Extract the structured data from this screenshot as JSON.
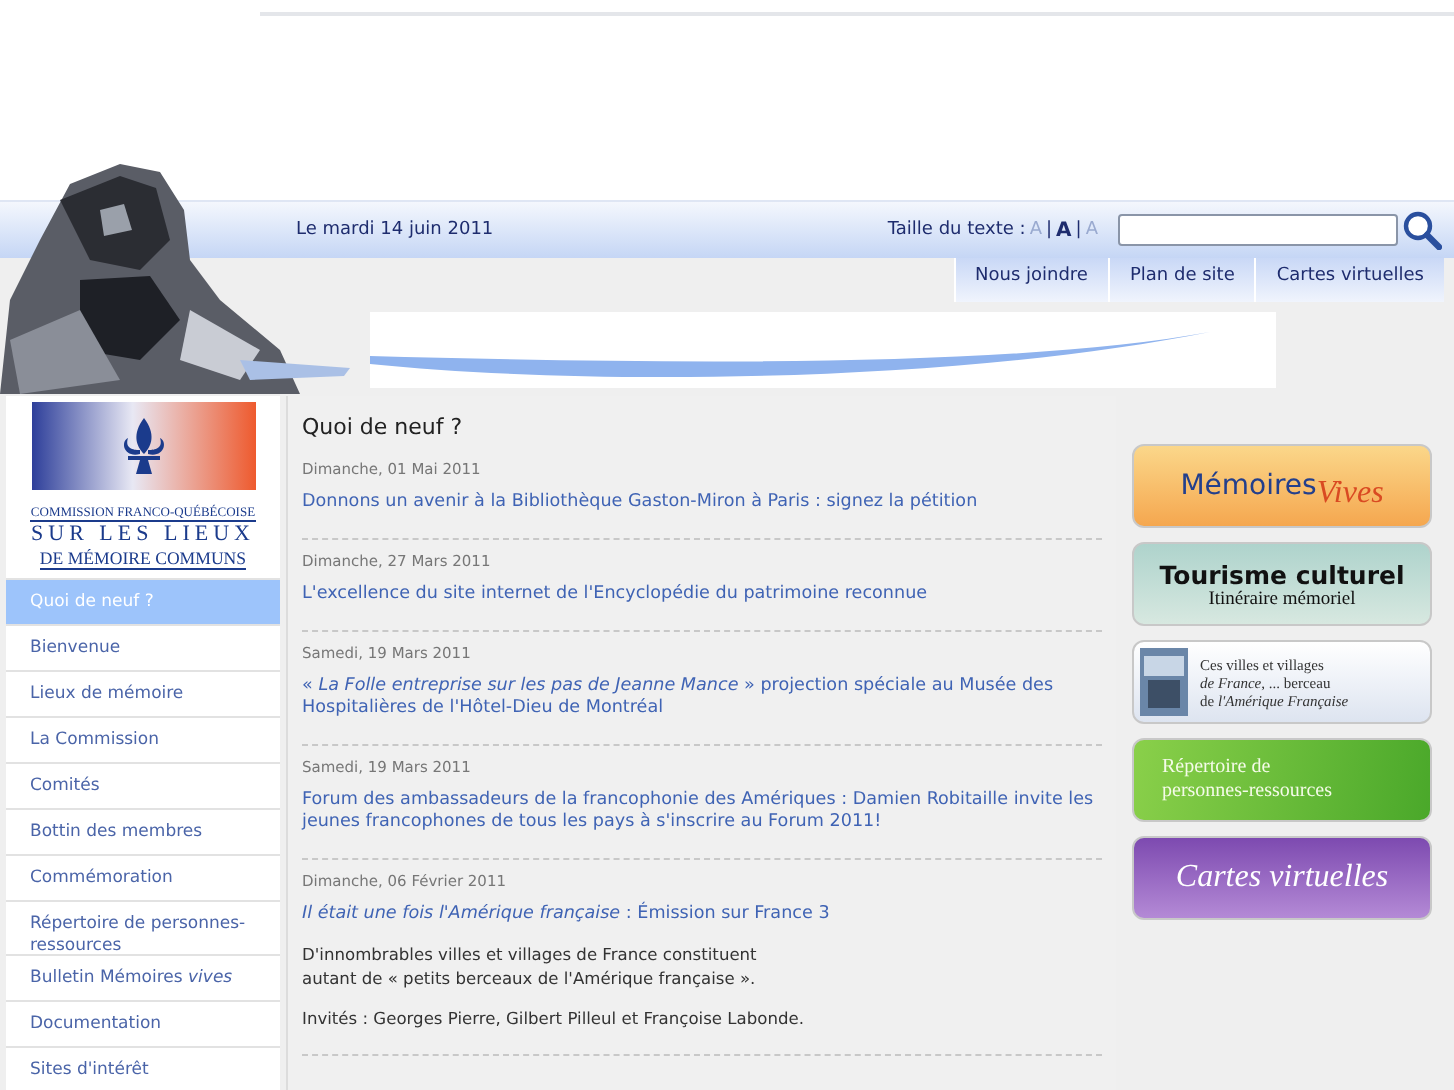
{
  "header": {
    "date": "Le mardi 14 juin 2011",
    "text_size_label": "Taille du texte :",
    "separators": [
      "|",
      "|"
    ],
    "text_sizes": [
      {
        "label": "A",
        "selected": false
      },
      {
        "label": "A",
        "selected": true
      },
      {
        "label": "A",
        "selected": false
      }
    ]
  },
  "top_links": [
    "Nous joindre",
    "Plan de site",
    "Cartes virtuelles"
  ],
  "logo": {
    "line_1": "COMMISSION FRANCO-QUÉBÉCOISE",
    "line_2": "SUR LES LIEUX",
    "line_3": "DE MÉMOIRE COMMUNS"
  },
  "sidebar": {
    "items": [
      {
        "label": "Quoi de neuf ?",
        "selected": true
      },
      {
        "label": "Bienvenue",
        "selected": false
      },
      {
        "label": "Lieux de mémoire",
        "selected": false
      },
      {
        "label": "La Commission",
        "selected": false
      },
      {
        "label": "Comités",
        "selected": false
      },
      {
        "label": "Bottin des membres",
        "selected": false
      },
      {
        "label": "Commémoration",
        "selected": false
      },
      {
        "label": "Répertoire de personnes-ressources",
        "selected": false
      },
      {
        "label": "Bulletin Mémoires *vives*",
        "selected": false
      },
      {
        "label": "Documentation",
        "selected": false
      },
      {
        "label": "Sites d'intérêt",
        "selected": false
      }
    ]
  },
  "main": {
    "title": "Quoi de neuf ?",
    "news": [
      {
        "date": "Dimanche, 01 Mai 2011",
        "title": "Donnons un avenir à la Bibliothèque Gaston-Miron à Paris : signez la pétition"
      },
      {
        "date": "Dimanche, 27 Mars 2011",
        "title": "L'excellence du site internet de l'Encyclopédie du patrimoine reconnue"
      },
      {
        "date": "Samedi, 19 Mars 2011",
        "title": "« *La Folle entreprise sur les pas de Jeanne Mance* » projection spéciale au Musée des Hospitalières de l'Hôtel-Dieu de Montréal"
      },
      {
        "date": "Samedi, 19 Mars 2011",
        "title": "Forum des ambassadeurs de la francophonie des Amériques : Damien Robitaille invite les jeunes francophones de tous les pays à s'inscrire au Forum 2011!"
      },
      {
        "date": "Dimanche, 06 Février 2011",
        "title": "*Il était une fois l'Amérique française* : Émission sur France 3",
        "paragraphs": [
          "D'innombrables villes et villages de France constituent\nautant de « petits berceaux de l'Amérique française ».",
          "Invités : Georges Pierre, Gilbert Pilleul et Françoise Labonde."
        ]
      }
    ]
  },
  "banners": [
    {
      "kind": "memoires",
      "text": "Mémoires",
      "text_2": "Vives"
    },
    {
      "kind": "tourisme",
      "text": "Tourisme culturel",
      "text_2": "Itinéraire mémoriel"
    },
    {
      "kind": "villes",
      "text": "Ces villes et villages\n*de France*, ... berceau\nde *l'Amérique Française*"
    },
    {
      "kind": "repertoire",
      "text": "Répertoire de\npersonnes-ressources"
    },
    {
      "kind": "cartes",
      "text": "Cartes virtuelles"
    }
  ]
}
